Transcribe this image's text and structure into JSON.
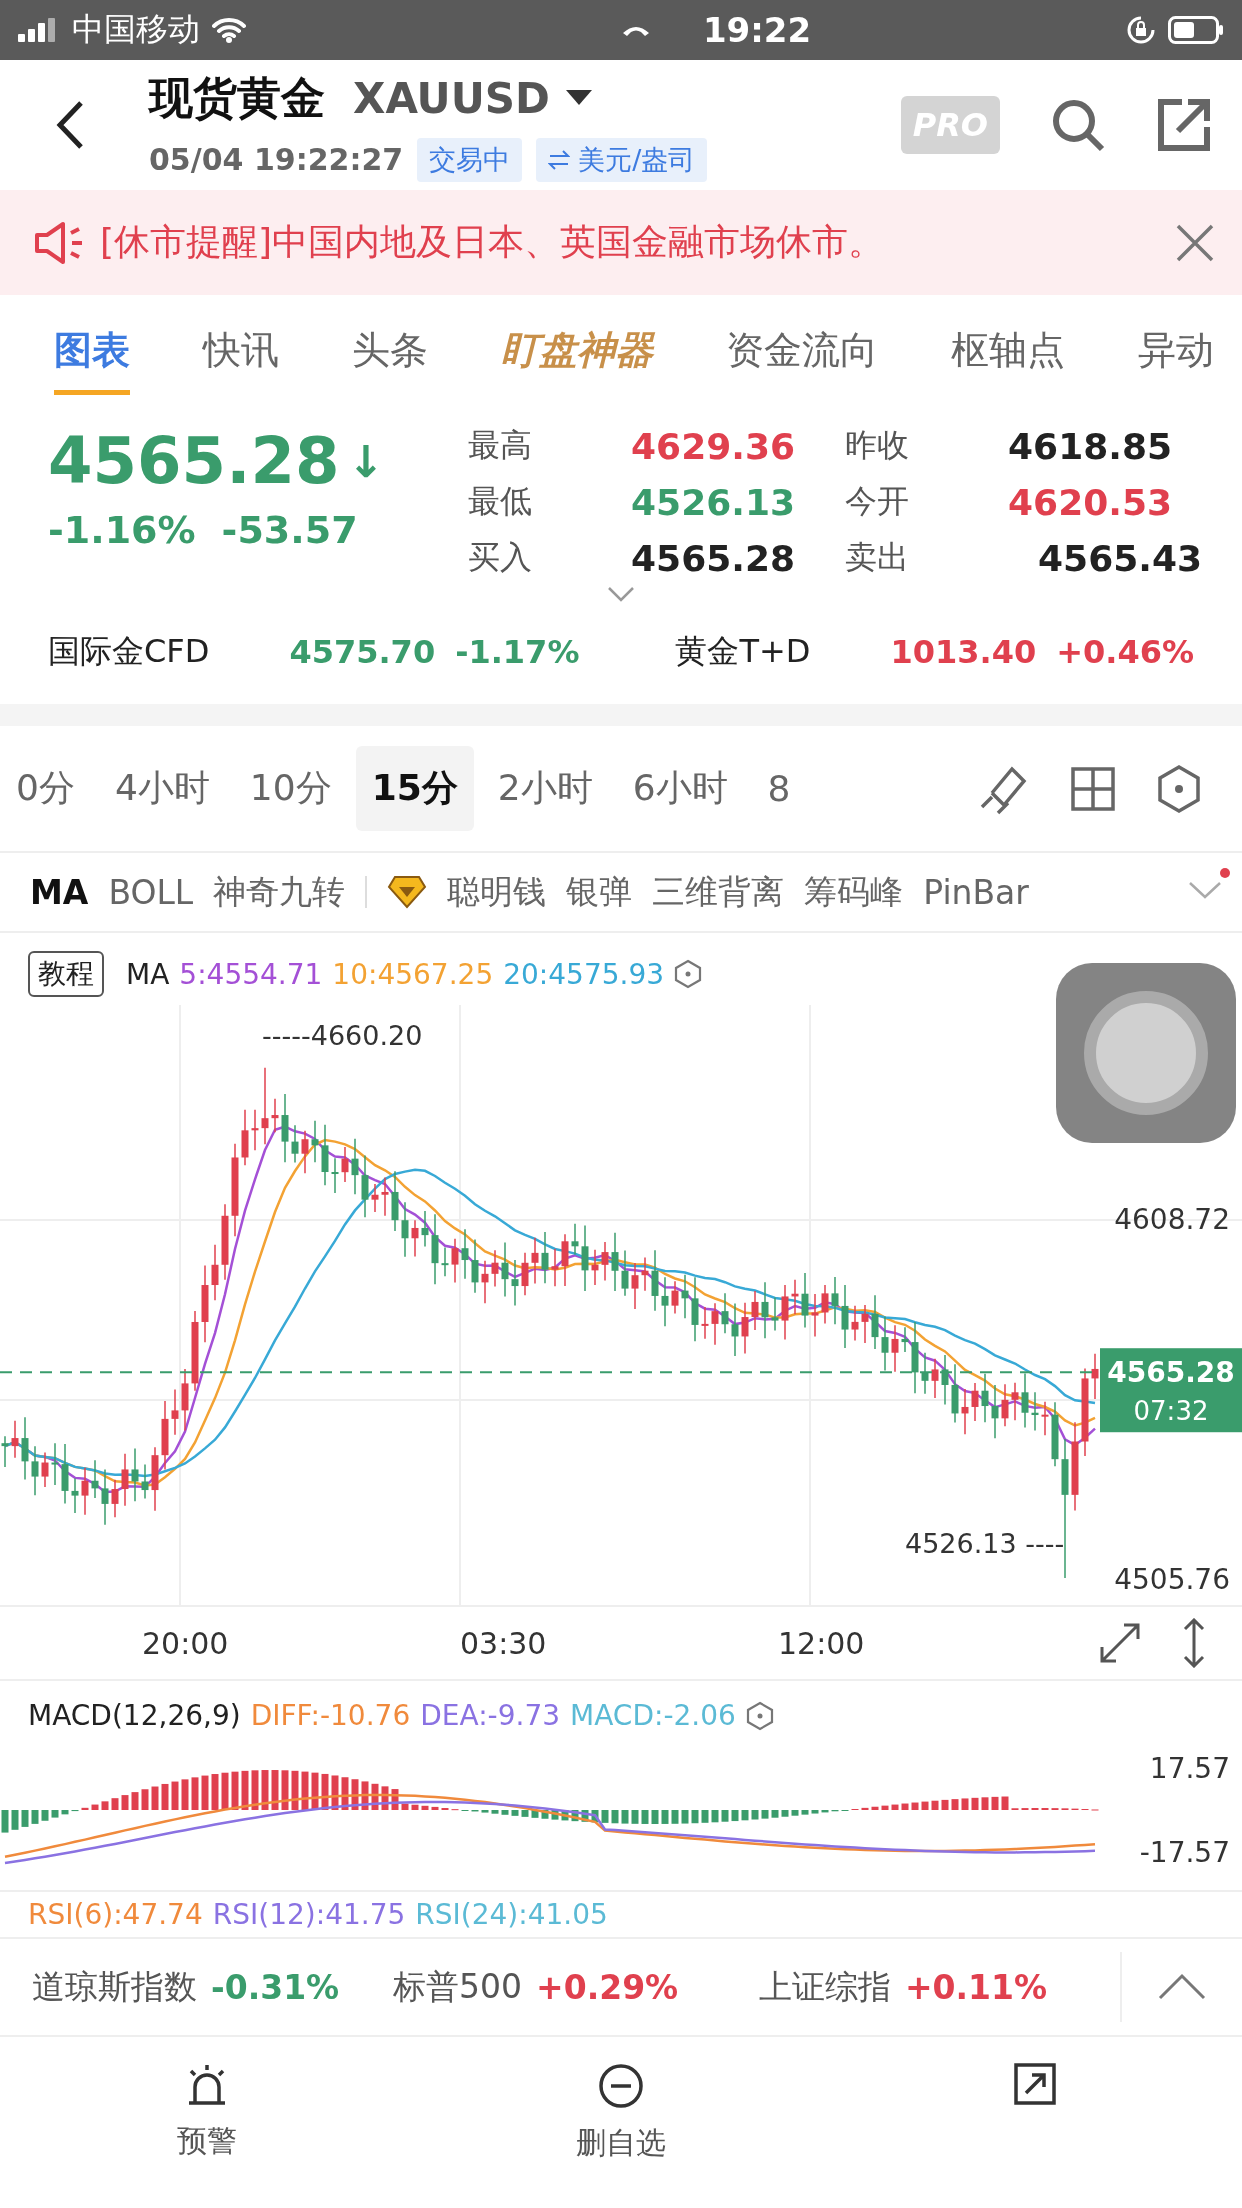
{
  "status_bar": {
    "carrier": "中国移动",
    "time": "19:22"
  },
  "header": {
    "title": "现货黄金",
    "symbol": "XAUUSD",
    "datetime": "05/04 19:22:27",
    "status_badge": "交易中",
    "unit_badge": "美元/盎司",
    "pro_label": "PRO"
  },
  "notice": {
    "text": "[休市提醒]中国内地及日本、英国金融市场休市。"
  },
  "tabs": [
    {
      "label": "图表",
      "selected": true,
      "kind": "normal"
    },
    {
      "label": "快讯",
      "selected": false,
      "kind": "normal"
    },
    {
      "label": "头条",
      "selected": false,
      "kind": "normal"
    },
    {
      "label": "盯盘神器",
      "selected": false,
      "kind": "featured"
    },
    {
      "label": "资金流向",
      "selected": false,
      "kind": "normal"
    },
    {
      "label": "枢轴点",
      "selected": false,
      "kind": "normal"
    },
    {
      "label": "异动",
      "selected": false,
      "kind": "normal"
    }
  ],
  "quote": {
    "price": "4565.28",
    "arrow": "↓",
    "color": "#3a9c6c",
    "change_pct": "-1.16%",
    "change": "-53.57",
    "stats": [
      {
        "label": "最高",
        "value": "4629.36",
        "color": "#e0404e"
      },
      {
        "label": "昨收",
        "value": "4618.85",
        "color": "#222222"
      },
      {
        "label": "最低",
        "value": "4526.13",
        "color": "#3a9c6c"
      },
      {
        "label": "今开",
        "value": "4620.53",
        "color": "#e0404e"
      },
      {
        "label": "买入",
        "value": "4565.28",
        "color": "#222222"
      },
      {
        "label": "卖出",
        "value": "4565.43",
        "color": "#222222"
      }
    ]
  },
  "related": [
    {
      "name": "国际金CFD",
      "price": "4575.70",
      "change": "-1.17%",
      "color": "#3a9c6c"
    },
    {
      "name": "黄金T+D",
      "price": "1013.40",
      "change": "+0.46%",
      "color": "#e0404e"
    }
  ],
  "periods": [
    {
      "label": "0分",
      "selected": false
    },
    {
      "label": "4小时",
      "selected": false
    },
    {
      "label": "10分",
      "selected": false
    },
    {
      "label": "15分",
      "selected": true
    },
    {
      "label": "2小时",
      "selected": false
    },
    {
      "label": "6小时",
      "selected": false
    },
    {
      "label": "8",
      "selected": false
    }
  ],
  "indicators": [
    {
      "label": "MA",
      "selected": true,
      "kind": "basic"
    },
    {
      "label": "BOLL",
      "selected": false,
      "kind": "basic"
    },
    {
      "label": "神奇九转",
      "selected": false,
      "kind": "basic"
    },
    {
      "label": "聪明钱",
      "selected": false,
      "kind": "premium"
    },
    {
      "label": "银弹",
      "selected": false,
      "kind": "basic"
    },
    {
      "label": "三维背离",
      "selected": false,
      "kind": "basic"
    },
    {
      "label": "筹码峰",
      "selected": false,
      "kind": "basic"
    },
    {
      "label": "PinBar",
      "selected": false,
      "kind": "basic"
    }
  ],
  "indicator_menu": {
    "has_new": true
  },
  "chart": {
    "tutorial_label": "教程",
    "ma_label": "MA",
    "ma_values": [
      {
        "text": "5:4554.71",
        "color": "#a450d6"
      },
      {
        "text": "10:4567.25",
        "color": "#f3a233"
      },
      {
        "text": "20:4575.93",
        "color": "#38a9d6"
      }
    ],
    "high_label": "-----4660.20",
    "low_label": "4526.13 ----",
    "axis_labels": [
      "4608.72",
      "4505.76"
    ],
    "last_price": "4565.28",
    "countdown": "07:32",
    "time_labels": [
      "20:00",
      "03:30",
      "12:00"
    ]
  },
  "macd": {
    "label": "MACD(12,26,9)",
    "values": [
      {
        "text": "DIFF:-10.76",
        "color": "#f08a3c"
      },
      {
        "text": "DEA:-9.73",
        "color": "#8a72e2"
      },
      {
        "text": "MACD:-2.06",
        "color": "#5bbad5"
      }
    ],
    "axis_labels": [
      "17.57",
      "-17.57"
    ]
  },
  "rsi": {
    "values": [
      {
        "text": "RSI(6):47.74",
        "color": "#f08a3c"
      },
      {
        "text": "RSI(12):41.75",
        "color": "#8a72e2"
      },
      {
        "text": "RSI(24):41.05",
        "color": "#5bbad5"
      }
    ]
  },
  "markets": [
    {
      "name": "道琼斯指数",
      "change": "-0.31%",
      "color": "#3a9c6c"
    },
    {
      "name": "标普500",
      "change": "+0.29%",
      "color": "#e0404e"
    },
    {
      "name": "上证综指",
      "change": "+0.11%",
      "color": "#e0404e"
    }
  ],
  "bottom_nav": [
    {
      "label": "预警",
      "kind": "alarm"
    },
    {
      "label": "删自选",
      "kind": "remove"
    },
    {
      "kind": "share"
    }
  ]
}
